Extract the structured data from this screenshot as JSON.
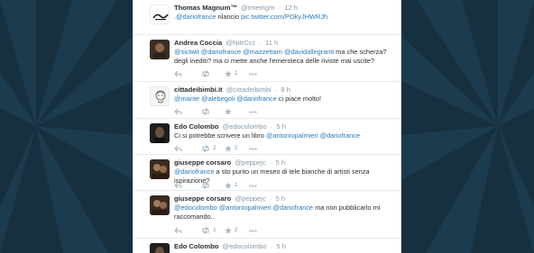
{
  "tweets": [
    {
      "name": "Thomas Magnum™",
      "handle": "@tmemgm",
      "time": "12 h",
      "segments": [
        {
          "t": ".@dariofrance",
          "link": true
        },
        {
          "t": " rilancio ",
          "link": false
        },
        {
          "t": "pic.twitter.com/POkyJHWRJh",
          "link": true
        }
      ],
      "retweets": "",
      "favorites": ""
    },
    {
      "name": "Andrea Coccia",
      "handle": "@NdrCcc",
      "time": "11 h",
      "segments": [
        {
          "t": "@sictwit",
          "link": true
        },
        {
          "t": " ",
          "link": false
        },
        {
          "t": "@dariofrance",
          "link": true
        },
        {
          "t": " ",
          "link": false
        },
        {
          "t": "@mazzettam",
          "link": true
        },
        {
          "t": " ",
          "link": false
        },
        {
          "t": "@davidallegranti",
          "link": true
        },
        {
          "t": " ma che scherza? degli inediti? ma ci mette anche l'emeroteca delle riviste mai uscite?",
          "link": false
        }
      ],
      "retweets": "",
      "favorites": "1"
    },
    {
      "name": "cittadeibimbi.it",
      "handle": "@cittadeibimbi",
      "time": "8 h",
      "segments": [
        {
          "t": "@mante",
          "link": true
        },
        {
          "t": " ",
          "link": false
        },
        {
          "t": "@alebegoli",
          "link": true
        },
        {
          "t": " ",
          "link": false
        },
        {
          "t": "@dariofrance",
          "link": true
        },
        {
          "t": " ci piace molto!",
          "link": false
        }
      ],
      "retweets": "",
      "favorites": ""
    },
    {
      "name": "Edo Colombo",
      "handle": "@edocolombo",
      "time": "5 h",
      "segments": [
        {
          "t": "Ci si potrebbe scrivere un libro ",
          "link": false
        },
        {
          "t": "@antoniopalmieri",
          "link": true
        },
        {
          "t": " ",
          "link": false
        },
        {
          "t": "@dariofrance",
          "link": true
        }
      ],
      "retweets": "2",
      "favorites": "2"
    },
    {
      "name": "giuseppe corsaro",
      "handle": "@peppejc",
      "time": "5 h",
      "segments": [
        {
          "t": "@dariofrance",
          "link": true
        },
        {
          "t": " a sto punto un meseo di tele bianche di artisti senza ispirazione?",
          "link": false
        }
      ],
      "retweets": "",
      "favorites": "1"
    },
    {
      "name": "giuseppe corsaro",
      "handle": "@peppejc",
      "time": "5 h",
      "segments": [
        {
          "t": "@edocolombo",
          "link": true
        },
        {
          "t": " ",
          "link": false
        },
        {
          "t": "@antoniopalmieri",
          "link": true
        },
        {
          "t": " ",
          "link": false
        },
        {
          "t": "@dariofrance",
          "link": true
        },
        {
          "t": " ma non pubblicarlo mi raccomando..",
          "link": false
        }
      ],
      "retweets": "1",
      "favorites": "2"
    },
    {
      "name": "Edo Colombo",
      "handle": "@edocolombo",
      "time": "5 h",
      "segments": [],
      "retweets": "",
      "favorites": ""
    }
  ],
  "colors": {
    "background": "#173040",
    "link": "#2b7bb9",
    "name": "#292f33",
    "meta": "#8899a6"
  }
}
